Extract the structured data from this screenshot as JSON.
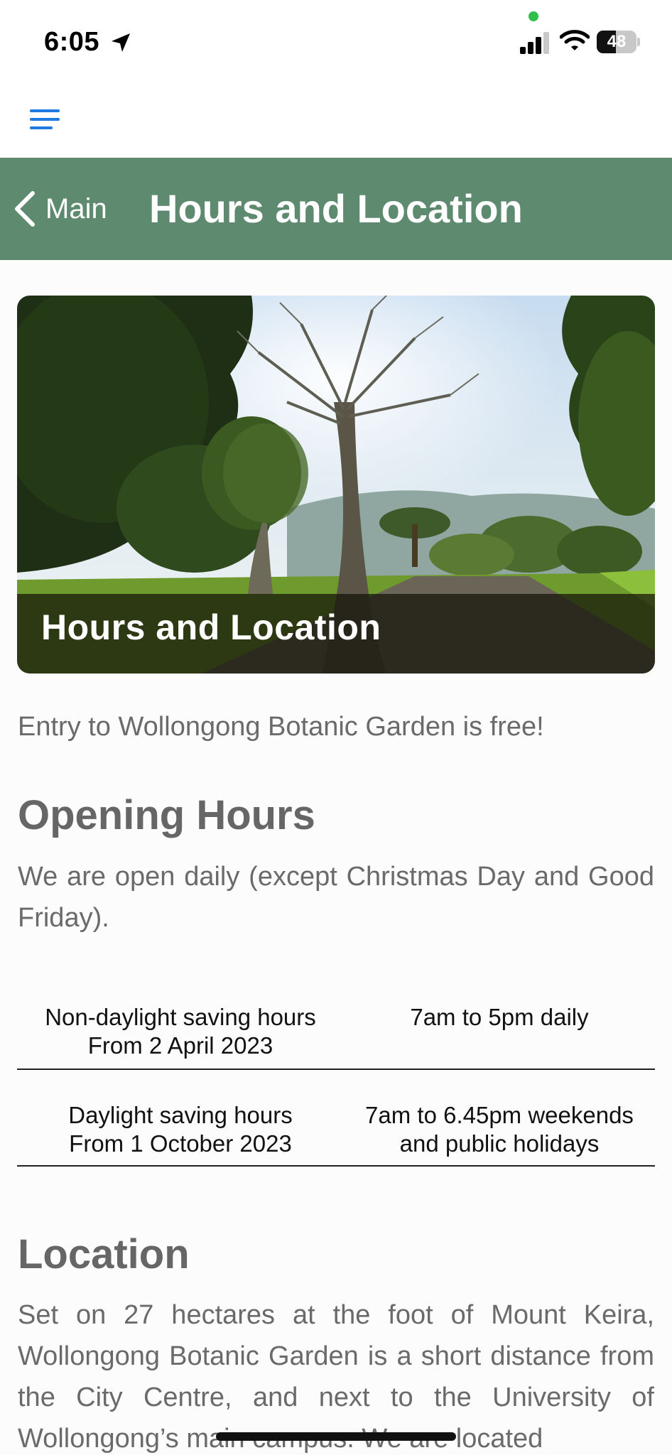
{
  "status_bar": {
    "time": "6:05",
    "battery_percent": "48",
    "battery_level": 0.48,
    "icons": [
      "location-arrow-icon",
      "camera-indicator-dot",
      "cellular-signal-icon",
      "wifi-icon",
      "battery-icon"
    ],
    "indicator_color": "#2fc04a"
  },
  "toolbar": {
    "menu_icon": "hamburger-menu-icon",
    "accent": "#1e7ae0"
  },
  "nav": {
    "back_label": "Main",
    "back_icon": "chevron-left-icon",
    "title": "Hours and Location",
    "header_color": "#5e8a6f"
  },
  "hero": {
    "caption": "Hours and Location"
  },
  "content": {
    "intro": "Entry to Wollongong Botanic Garden is free!",
    "opening_hours": {
      "heading": "Opening Hours",
      "text": "We are open daily (except Christmas Day and Good Friday)."
    },
    "hours_table": [
      {
        "label_line1": "Non-daylight saving hours",
        "label_line2": "From 2 April 2023",
        "hours_line1": "7am to 5pm daily",
        "hours_line2": ""
      },
      {
        "label_line1": "Daylight saving hours",
        "label_line2": "From 1 October 2023",
        "hours_line1": "7am to 6.45pm weekends",
        "hours_line2": "and public holidays"
      }
    ],
    "location": {
      "heading": "Location",
      "text": "Set on 27 hectares at the foot of Mount Keira, Wollongong Botanic Garden is a short distance from the City Centre, and next to the University of Wollongong’s main campus. We are located"
    }
  }
}
